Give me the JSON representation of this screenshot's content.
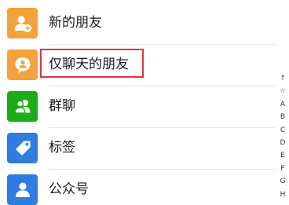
{
  "colors": {
    "orange": "#f4a23c",
    "green": "#1aad19",
    "blue": "#2f7de1",
    "highlight_border": "#d9363e"
  },
  "items": [
    {
      "label": "新的朋友",
      "icon": "add-friend-icon",
      "color": "#f4a23c"
    },
    {
      "label": "仅聊天的朋友",
      "icon": "chat-only-friend-icon",
      "color": "#f4a23c"
    },
    {
      "label": "群聊",
      "icon": "group-chat-icon",
      "color": "#1aad19"
    },
    {
      "label": "标签",
      "icon": "tag-icon",
      "color": "#2f7de1"
    },
    {
      "label": "公众号",
      "icon": "official-account-icon",
      "color": "#2f7de1"
    }
  ],
  "index_bar": [
    "↑",
    "☆",
    "A",
    "B",
    "C",
    "D",
    "E",
    "F",
    "G",
    "H"
  ]
}
